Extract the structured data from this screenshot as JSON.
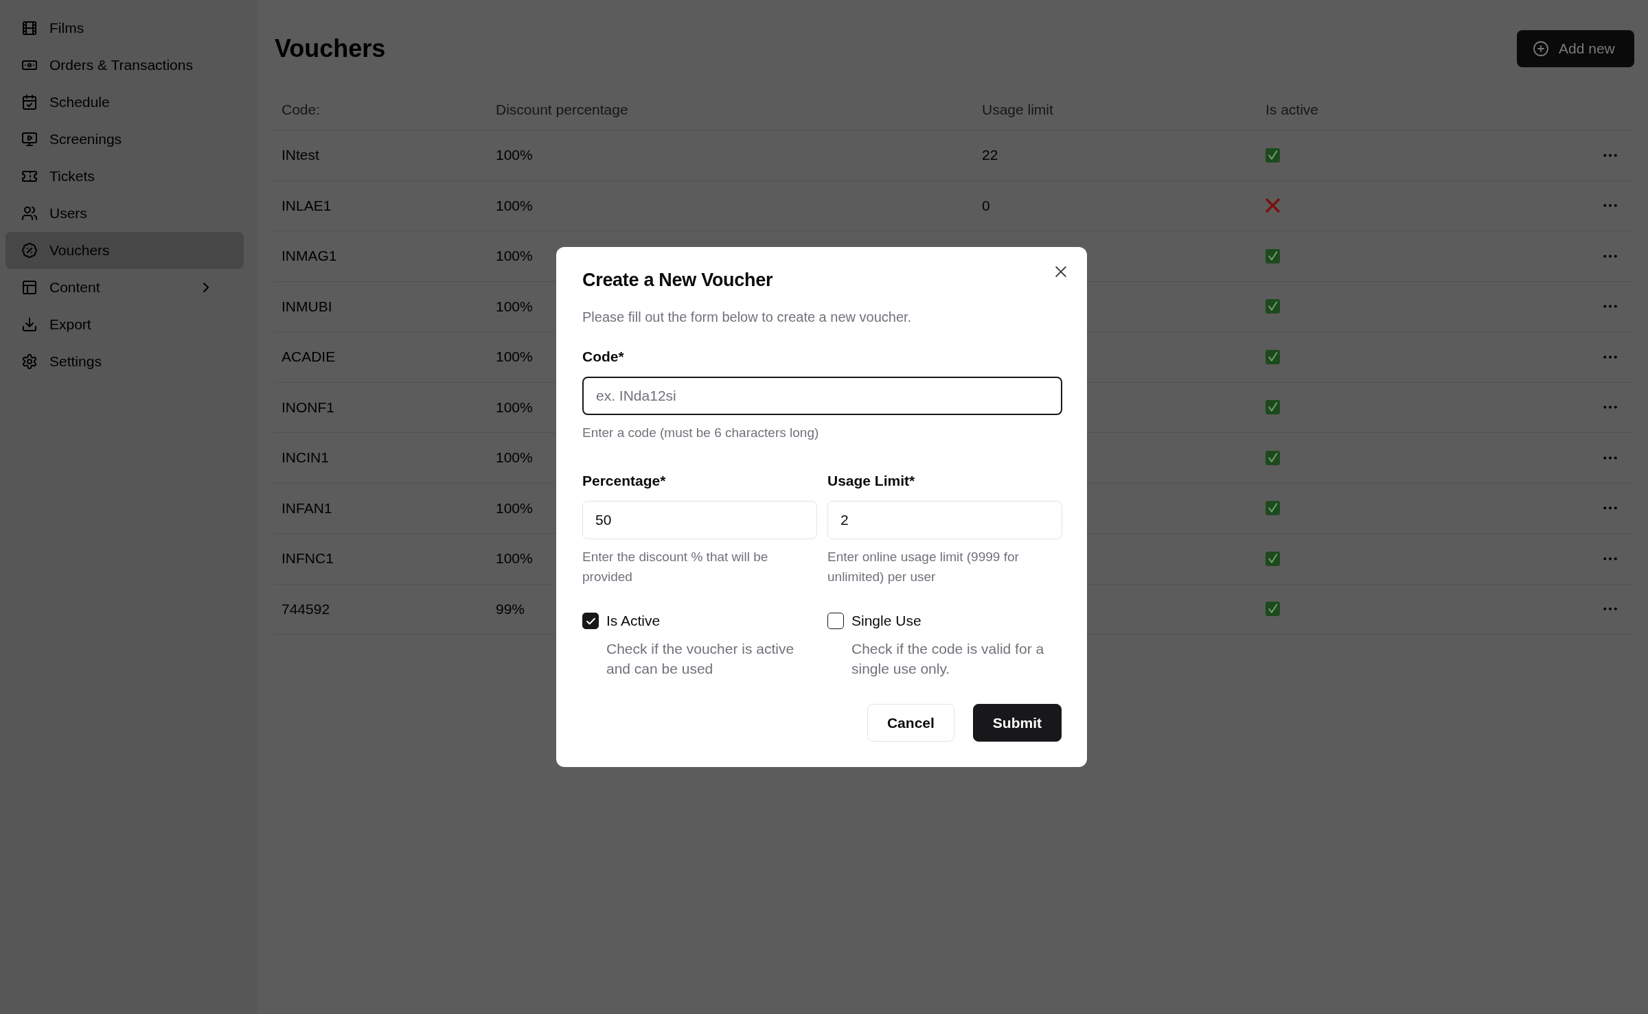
{
  "sidebar": {
    "items": [
      {
        "label": "Films",
        "selected": false,
        "expandable": false
      },
      {
        "label": "Orders & Transactions",
        "selected": false,
        "expandable": false
      },
      {
        "label": "Schedule",
        "selected": false,
        "expandable": false
      },
      {
        "label": "Screenings",
        "selected": false,
        "expandable": false
      },
      {
        "label": "Tickets",
        "selected": false,
        "expandable": false
      },
      {
        "label": "Users",
        "selected": false,
        "expandable": false
      },
      {
        "label": "Vouchers",
        "selected": true,
        "expandable": false
      },
      {
        "label": "Content",
        "selected": false,
        "expandable": true
      },
      {
        "label": "Export",
        "selected": false,
        "expandable": false
      },
      {
        "label": "Settings",
        "selected": false,
        "expandable": false
      }
    ]
  },
  "header": {
    "title": "Vouchers",
    "add_button": "Add new"
  },
  "table": {
    "columns": [
      "Code:",
      "Discount percentage",
      "Usage limit",
      "Is active"
    ],
    "rows": [
      {
        "code": "INtest",
        "discount": "100%",
        "usage_limit": "22",
        "active": true
      },
      {
        "code": "INLAE1",
        "discount": "100%",
        "usage_limit": "0",
        "active": false
      },
      {
        "code": "INMAG1",
        "discount": "100%",
        "active": true
      },
      {
        "code": "INMUBI",
        "discount": "100%",
        "active": true
      },
      {
        "code": "ACADIE",
        "discount": "100%",
        "active": true
      },
      {
        "code": "INONF1",
        "discount": "100%",
        "active": true
      },
      {
        "code": "INCIN1",
        "discount": "100%",
        "active": true
      },
      {
        "code": "INFAN1",
        "discount": "100%",
        "active": true
      },
      {
        "code": "INFNC1",
        "discount": "100%",
        "active": true
      },
      {
        "code": "744592",
        "discount": "99%",
        "active": true
      }
    ]
  },
  "dialog": {
    "title": "Create a New Voucher",
    "description": "Please fill out the form below to create a new voucher.",
    "fields": [
      {
        "label": "Code*",
        "placeholder": "ex. INda12si",
        "hint": "Enter a code (must be 6 characters long)",
        "focused": true
      },
      {
        "label": "Percentage*",
        "value": "50",
        "hint": "Enter the discount % that will be provided",
        "focused": false
      },
      {
        "label": "Usage Limit*",
        "value": "2",
        "hint": "Enter online usage limit (9999 for unlimited) per user",
        "focused": false
      }
    ],
    "checkboxes": [
      {
        "label": "Is Active",
        "description": "Check if the voucher is active and can be used",
        "checked": true
      },
      {
        "label": "Single Use",
        "description": "Check if the code is valid for a single use only.",
        "checked": false
      }
    ],
    "buttons": [
      {
        "label": "Cancel",
        "kind": "outline"
      },
      {
        "label": "Submit",
        "kind": "filled"
      }
    ]
  }
}
